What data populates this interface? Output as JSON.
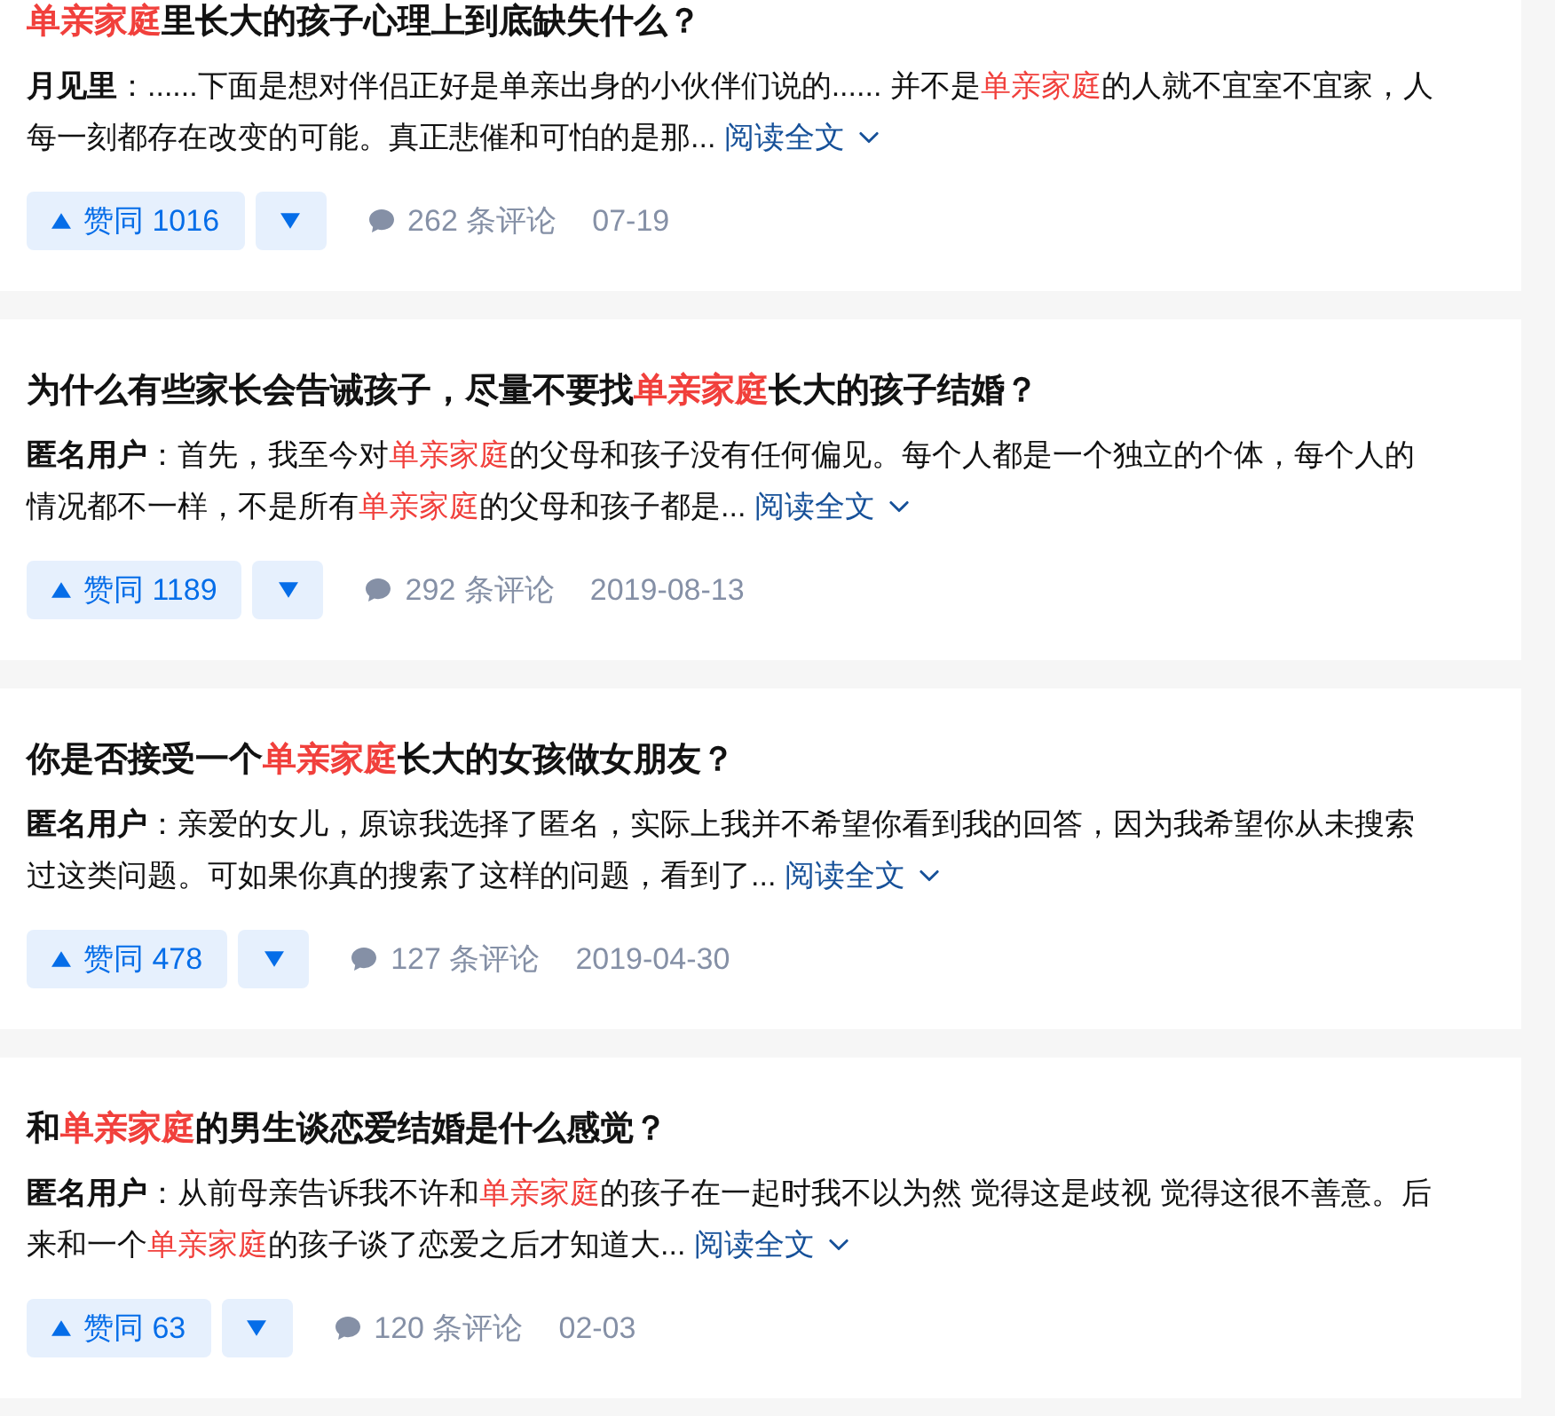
{
  "answers": [
    {
      "title": [
        {
          "text": "单亲家庭",
          "highlight": true
        },
        {
          "text": "里长大的孩子心理上到底缺失什么？",
          "highlight": false
        }
      ],
      "author": "月见里",
      "excerpt": [
        {
          "text": "：......下面是想对伴侣正好是单亲出身的小伙伴们说的...... 并不是",
          "highlight": false
        },
        {
          "text": "单亲家庭",
          "highlight": true
        },
        {
          "text": "的人就不宜室不宜家，人每一刻都存在改变的可能。真正悲催和可怕的是那...",
          "highlight": false
        }
      ],
      "read_more": "阅读全文",
      "upvote": "赞同 1016",
      "comments": "262 条评论",
      "date": "07-19"
    },
    {
      "title": [
        {
          "text": "为什么有些家长会告诫孩子，尽量不要找",
          "highlight": false
        },
        {
          "text": "单亲家庭",
          "highlight": true
        },
        {
          "text": "长大的孩子结婚？",
          "highlight": false
        }
      ],
      "author": "匿名用户",
      "excerpt": [
        {
          "text": "：首先，我至今对",
          "highlight": false
        },
        {
          "text": "单亲家庭",
          "highlight": true
        },
        {
          "text": "的父母和孩子没有任何偏见。每个人都是一个独立的个体，每个人的情况都不一样，不是所有",
          "highlight": false
        },
        {
          "text": "单亲家庭",
          "highlight": true
        },
        {
          "text": "的父母和孩子都是...",
          "highlight": false
        }
      ],
      "read_more": "阅读全文",
      "upvote": "赞同 1189",
      "comments": "292 条评论",
      "date": "2019-08-13"
    },
    {
      "title": [
        {
          "text": "你是否接受一个",
          "highlight": false
        },
        {
          "text": "单亲家庭",
          "highlight": true
        },
        {
          "text": "长大的女孩做女朋友？",
          "highlight": false
        }
      ],
      "author": "匿名用户",
      "excerpt": [
        {
          "text": "：亲爱的女儿，原谅我选择了匿名，实际上我并不希望你看到我的回答，因为我希望你从未搜索过这类问题。可如果你真的搜索了这样的问题，看到了...",
          "highlight": false
        }
      ],
      "read_more": "阅读全文",
      "upvote": "赞同 478",
      "comments": "127 条评论",
      "date": "2019-04-30"
    },
    {
      "title": [
        {
          "text": "和",
          "highlight": false
        },
        {
          "text": "单亲家庭",
          "highlight": true
        },
        {
          "text": "的男生谈恋爱结婚是什么感觉？",
          "highlight": false
        }
      ],
      "author": "匿名用户",
      "excerpt": [
        {
          "text": "：从前母亲告诉我不许和",
          "highlight": false
        },
        {
          "text": "单亲家庭",
          "highlight": true
        },
        {
          "text": "的孩子在一起时我不以为然 觉得这是歧视 觉得这很不善意。后来和一个",
          "highlight": false
        },
        {
          "text": "单亲家庭",
          "highlight": true
        },
        {
          "text": "的孩子谈了恋爱之后才知道大...",
          "highlight": false
        }
      ],
      "read_more": "阅读全文",
      "upvote": "赞同 63",
      "comments": "120 条评论",
      "date": "02-03"
    }
  ]
}
